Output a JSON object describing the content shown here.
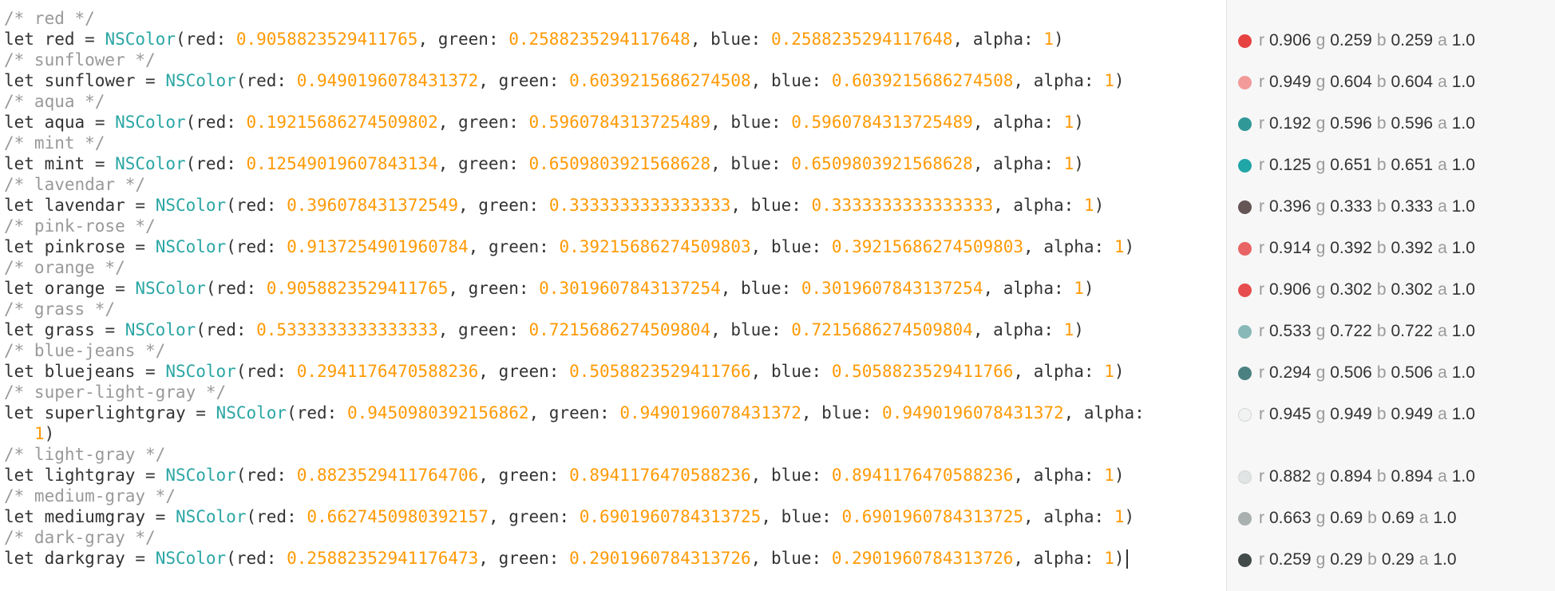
{
  "lines": [
    {
      "comment": "/* red */",
      "name": "red",
      "r": "0.9058823529411765",
      "g": "0.2588235294117648",
      "b": "0.2588235294117648",
      "a": "1"
    },
    {
      "comment": "/* sunflower */",
      "name": "sunflower",
      "r": "0.9490196078431372",
      "g": "0.6039215686274508",
      "b": "0.6039215686274508",
      "a": "1"
    },
    {
      "comment": "/* aqua */",
      "name": "aqua",
      "r": "0.19215686274509802",
      "g": "0.5960784313725489",
      "b": "0.5960784313725489",
      "a": "1"
    },
    {
      "comment": "/* mint */",
      "name": "mint",
      "r": "0.12549019607843134",
      "g": "0.6509803921568628",
      "b": "0.6509803921568628",
      "a": "1"
    },
    {
      "comment": "/* lavendar */",
      "name": "lavendar",
      "r": "0.396078431372549",
      "g": "0.3333333333333333",
      "b": "0.3333333333333333",
      "a": "1"
    },
    {
      "comment": "/* pink-rose */",
      "name": "pinkrose",
      "r": "0.9137254901960784",
      "g": "0.39215686274509803",
      "b": "0.39215686274509803",
      "a": "1"
    },
    {
      "comment": "/* orange */",
      "name": "orange",
      "r": "0.9058823529411765",
      "g": "0.3019607843137254",
      "b": "0.3019607843137254",
      "a": "1"
    },
    {
      "comment": "/* grass */",
      "name": "grass",
      "r": "0.5333333333333333",
      "g": "0.7215686274509804",
      "b": "0.7215686274509804",
      "a": "1"
    },
    {
      "comment": "/* blue-jeans */",
      "name": "bluejeans",
      "r": "0.2941176470588236",
      "g": "0.5058823529411766",
      "b": "0.5058823529411766",
      "a": "1"
    },
    {
      "comment": "/* super-light-gray */",
      "name": "superlightgray",
      "r": "0.9450980392156862",
      "g": "0.9490196078431372",
      "b": "0.9490196078431372",
      "a": "1"
    },
    {
      "comment": "/* light-gray */",
      "name": "lightgray",
      "r": "0.8823529411764706",
      "g": "0.8941176470588236",
      "b": "0.8941176470588236",
      "a": "1"
    },
    {
      "comment": "/* medium-gray */",
      "name": "mediumgray",
      "r": "0.6627450980392157",
      "g": "0.6901960784313725",
      "b": "0.6901960784313725",
      "a": "1"
    },
    {
      "comment": "/* dark-gray */",
      "name": "darkgray",
      "r": "0.25882352941176473",
      "g": "0.2901960784313726",
      "b": "0.2901960784313726",
      "a": "1"
    }
  ],
  "results": [
    {
      "r": "0.906",
      "g": "0.259",
      "b": "0.259",
      "a": "1.0",
      "color": "#e74242"
    },
    {
      "r": "0.949",
      "g": "0.604",
      "b": "0.604",
      "a": "1.0",
      "color": "#f29a9a"
    },
    {
      "r": "0.192",
      "g": "0.596",
      "b": "0.596",
      "a": "1.0",
      "color": "#319898"
    },
    {
      "r": "0.125",
      "g": "0.651",
      "b": "0.651",
      "a": "1.0",
      "color": "#20a6a6"
    },
    {
      "r": "0.396",
      "g": "0.333",
      "b": "0.333",
      "a": "1.0",
      "color": "#655555"
    },
    {
      "r": "0.914",
      "g": "0.392",
      "b": "0.392",
      "a": "1.0",
      "color": "#e96464"
    },
    {
      "r": "0.906",
      "g": "0.302",
      "b": "0.302",
      "a": "1.0",
      "color": "#e74d4d"
    },
    {
      "r": "0.533",
      "g": "0.722",
      "b": "0.722",
      "a": "1.0",
      "color": "#88b8b8"
    },
    {
      "r": "0.294",
      "g": "0.506",
      "b": "0.506",
      "a": "1.0",
      "color": "#4b8181"
    },
    {
      "r": "0.945",
      "g": "0.949",
      "b": "0.949",
      "a": "1.0",
      "color": "#f1f2f2"
    },
    {
      "r": "0.882",
      "g": "0.894",
      "b": "0.894",
      "a": "1.0",
      "color": "#e1e4e4"
    },
    {
      "r": "0.663",
      "g": "0.69",
      "b": "0.69",
      "a": "1.0",
      "color": "#a9b0b0"
    },
    {
      "r": "0.259",
      "g": "0.29",
      "b": "0.29",
      "a": "1.0",
      "color": "#424a4a"
    }
  ],
  "syntax": {
    "let": "let",
    "eq": " = ",
    "type": "NSColor",
    "red": "red: ",
    "green": ", green: ",
    "blue": ", blue: ",
    "alpha": ", alpha: ",
    "close": ")",
    "r": "r",
    "g": "g",
    "b": "b",
    "a": "a"
  },
  "colors": {
    "comment": "#999999",
    "type": "#2aa6a4",
    "number": "#ff9a05",
    "text": "#333333"
  }
}
